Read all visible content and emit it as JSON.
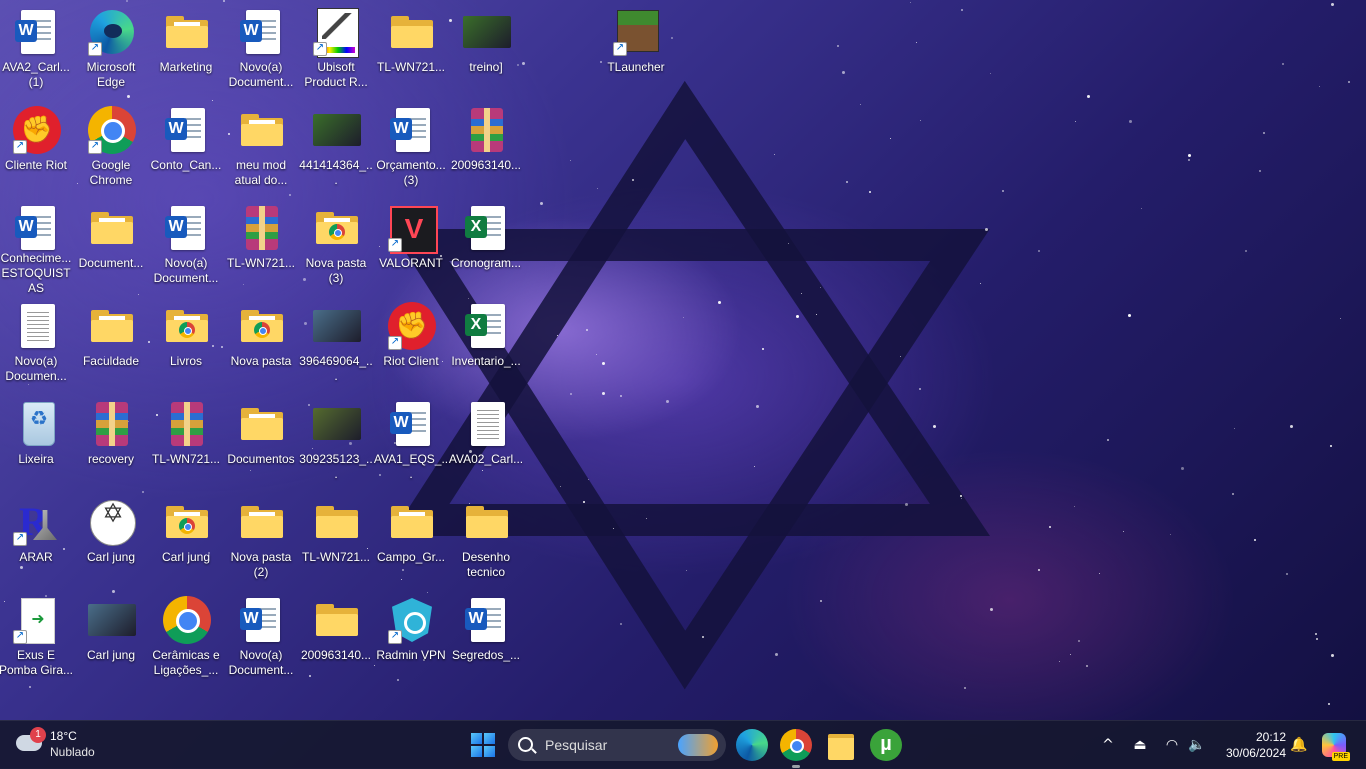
{
  "desktop": {
    "icons": [
      {
        "label": "AVA2_Carl... (1)",
        "type": "word"
      },
      {
        "label": "Microsoft Edge",
        "type": "edge",
        "shortcut": true
      },
      {
        "label": "Marketing",
        "type": "folder"
      },
      {
        "label": "Novo(a) Document...",
        "type": "word"
      },
      {
        "label": "Ubisoft Product R...",
        "type": "ubisoft",
        "shortcut": true
      },
      {
        "label": "TL-WN721...",
        "type": "folder-empty"
      },
      {
        "label": "treino]",
        "type": "image"
      },
      {
        "label": "TLauncher",
        "type": "minecraft",
        "shortcut": true
      },
      {
        "label": "Cliente Riot",
        "type": "riot",
        "shortcut": true
      },
      {
        "label": "Google Chrome",
        "type": "chrome",
        "shortcut": true
      },
      {
        "label": "Conto_Can...",
        "type": "word"
      },
      {
        "label": "meu mod atual do...",
        "type": "folder"
      },
      {
        "label": "441414364_...",
        "type": "image"
      },
      {
        "label": "Orçamento... (3)",
        "type": "word"
      },
      {
        "label": "200963140...",
        "type": "rar"
      },
      {
        "label": "Conhecime... ESTOQUISTAS",
        "type": "word"
      },
      {
        "label": "Document...",
        "type": "folder"
      },
      {
        "label": "Novo(a) Document...",
        "type": "word"
      },
      {
        "label": "TL-WN721...",
        "type": "rar"
      },
      {
        "label": "Nova pasta (3)",
        "type": "folder-chrome"
      },
      {
        "label": "VALORANT",
        "type": "valorant",
        "shortcut": true
      },
      {
        "label": "Cronogram...",
        "type": "excel"
      },
      {
        "label": "Novo(a) Documen...",
        "type": "text"
      },
      {
        "label": "Faculdade",
        "type": "folder"
      },
      {
        "label": "Livros",
        "type": "folder-chrome"
      },
      {
        "label": "Nova pasta",
        "type": "folder-chrome"
      },
      {
        "label": "396469064_...",
        "type": "image"
      },
      {
        "label": "Riot Client",
        "type": "riot",
        "shortcut": true
      },
      {
        "label": "Inventario_...",
        "type": "excel"
      },
      {
        "label": "Lixeira",
        "type": "recycle"
      },
      {
        "label": "recovery",
        "type": "rar"
      },
      {
        "label": "TL-WN721...",
        "type": "rar"
      },
      {
        "label": "Documentos",
        "type": "folder"
      },
      {
        "label": "309235123_...",
        "type": "image"
      },
      {
        "label": "AVA1_EQS_...",
        "type": "word"
      },
      {
        "label": "AVA02_Carl...",
        "type": "text"
      },
      {
        "label": "ARAR",
        "type": "arar",
        "shortcut": true
      },
      {
        "label": "Carl jung",
        "type": "wheel"
      },
      {
        "label": "Carl jung",
        "type": "folder-chrome"
      },
      {
        "label": "Nova pasta (2)",
        "type": "folder"
      },
      {
        "label": "TL-WN721...",
        "type": "folder-empty"
      },
      {
        "label": "Campo_Gr...",
        "type": "folder"
      },
      {
        "label": "Desenho tecnico",
        "type": "folder-empty"
      },
      {
        "label": "Exus E Pomba Gira...",
        "type": "docgreen",
        "shortcut": true
      },
      {
        "label": "Carl jung",
        "type": "image"
      },
      {
        "label": "Cerâmicas e Ligações_...",
        "type": "chrome"
      },
      {
        "label": "Novo(a) Document...",
        "type": "word"
      },
      {
        "label": "200963140...",
        "type": "folder-empty"
      },
      {
        "label": "Radmin VPN",
        "type": "radmin",
        "shortcut": true
      },
      {
        "label": "Segredos_...",
        "type": "word"
      }
    ]
  },
  "taskbar": {
    "weather": {
      "temp": "18°C",
      "condition": "Nublado",
      "notifications": "1"
    },
    "search": {
      "placeholder": "Pesquisar"
    },
    "pinned_apps": [
      "Microsoft Edge",
      "Google Chrome",
      "File Explorer",
      "µTorrent"
    ],
    "tray": {
      "chevron": "^",
      "time": "20:12",
      "date": "30/06/2024"
    },
    "copilot_badge": "PRE"
  },
  "colors": {
    "taskbar_bg": "#161830",
    "folder": "#ffd765",
    "word": "#185abd",
    "excel": "#107c41"
  }
}
